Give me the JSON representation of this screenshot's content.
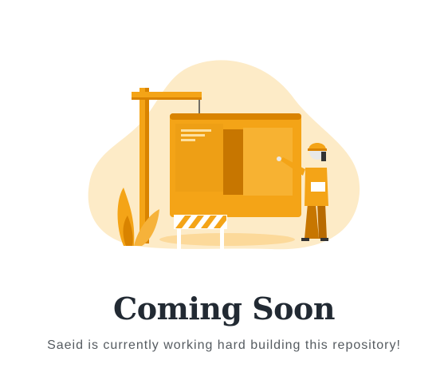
{
  "illustration": {
    "name": "under-construction-illustration",
    "colors": {
      "blob": "#fdebc7",
      "primary": "#f4a417",
      "primary_dark": "#d98300",
      "shadow": "#fcd99a",
      "barrier_white": "#ffffff",
      "worker_helmet": "#f4a417",
      "skin": "#e8e8e8"
    }
  },
  "heading": {
    "title": "Coming Soon",
    "subtitle": "Saeid is currently working hard building this repository!"
  }
}
